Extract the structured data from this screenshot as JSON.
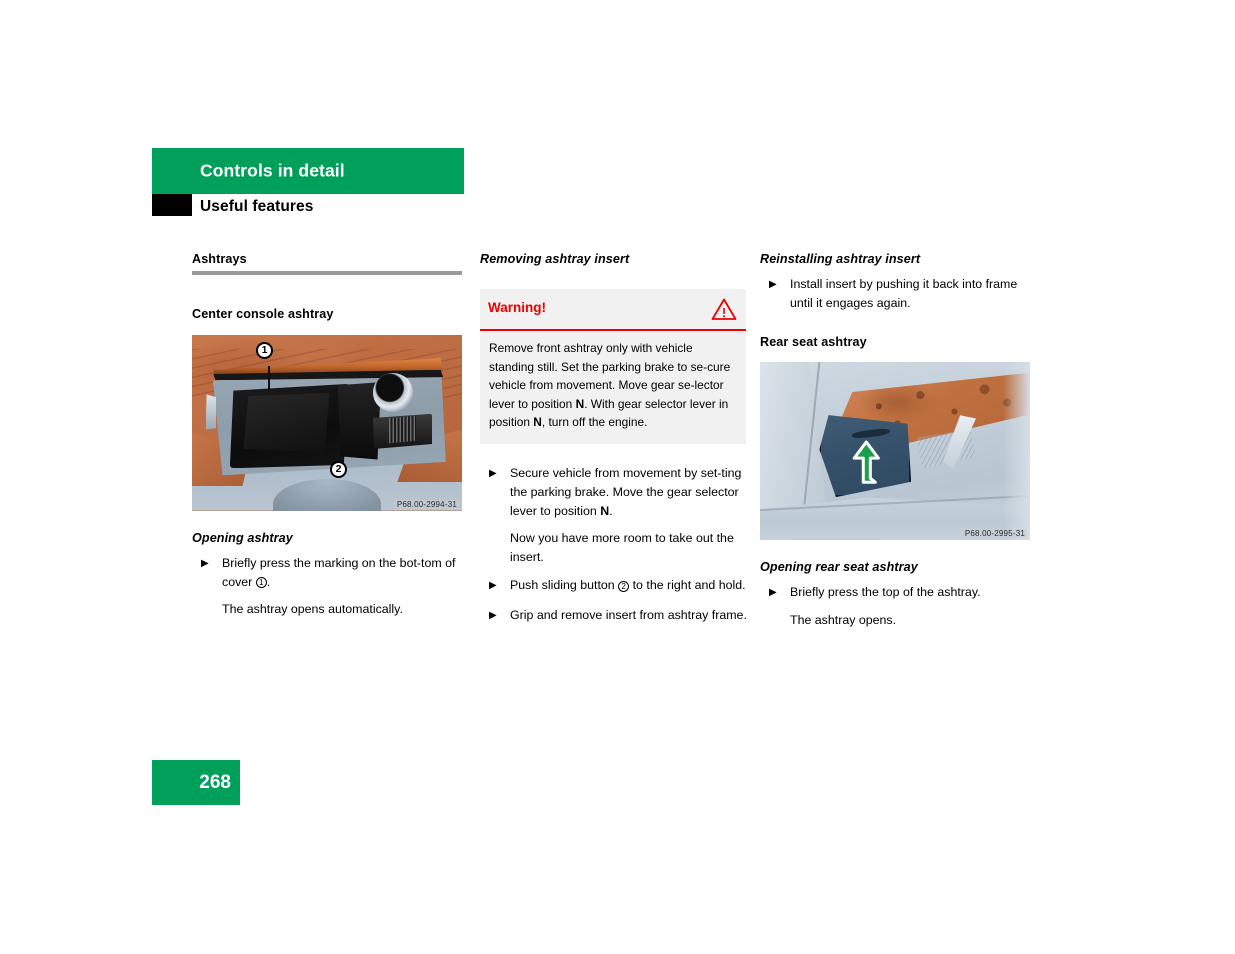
{
  "header": {
    "chapter_title": "Controls in detail",
    "section_title": "Useful features",
    "accent_color": "#00A05A",
    "tab_color": "#000000"
  },
  "columns": {
    "left": {
      "section_heading": "Ashtrays",
      "sub_heading": "Center console ashtray",
      "figure": {
        "caption_id": "P68.00-2994-31",
        "callouts": [
          {
            "number": "1",
            "label": "cover-callout"
          },
          {
            "number": "2",
            "label": "sliding-button-callout"
          }
        ],
        "alt": "Open center console ashtray with wood trim cover and sliding button"
      },
      "procedure_heading": "Opening ashtray",
      "steps": [
        {
          "marker": "▶",
          "text_before": "Briefly press the marking on the bot-tom of cover ",
          "callout": "1",
          "text_after": "."
        }
      ],
      "note": "The ashtray opens automatically."
    },
    "middle": {
      "heading": "Removing ashtray insert",
      "warning": {
        "label": "Warning!",
        "icon": "warning-triangle-icon",
        "color": "#ee0000",
        "body_part_1": "Remove front ashtray only with vehicle standing still. Set the parking brake to se-cure vehicle from movement. Move gear se-lector lever to position ",
        "body_bold_1": "N",
        "body_part_2": ". With gear selector lever in position ",
        "body_bold_2": "N",
        "body_part_3": ", turn off the engine."
      },
      "steps": [
        {
          "marker": "▶",
          "text_before": "Secure vehicle from movement by set-ting the parking brake. Move the gear selector lever to position ",
          "bold": "N",
          "text_after": "."
        },
        {
          "marker": "▶",
          "text_before": "Push sliding button ",
          "callout": "2",
          "text_after": " to the right and hold."
        },
        {
          "marker": "▶",
          "text_before": "Grip and remove insert from ashtray frame."
        }
      ],
      "note": "Now you have more room to take out the insert."
    },
    "right": {
      "heading_1": "Reinstalling ashtray insert",
      "step_1": "Install insert by pushing it back into frame until it engages again.",
      "step_1_marker": "▶",
      "sub_heading": "Rear seat ashtray",
      "figure": {
        "caption_id": "P68.00-2995-31",
        "arrow_color": "#18A04A",
        "alt": "Rear seat ashtray in door panel with green arrow pointing upward"
      },
      "procedure_heading": "Opening rear seat ashtray",
      "step_2": "Briefly press the top of the ashtray.",
      "step_2_marker": "▶",
      "note": "The ashtray opens."
    }
  },
  "footer": {
    "page_number": "268"
  }
}
